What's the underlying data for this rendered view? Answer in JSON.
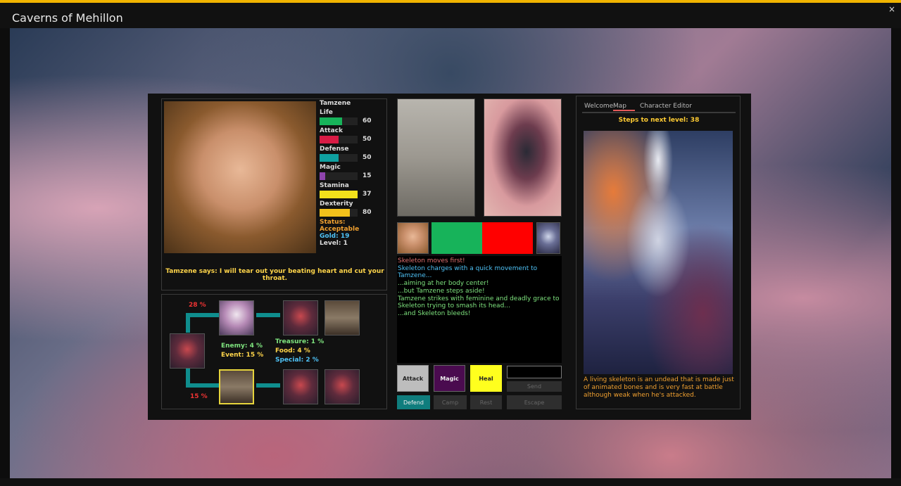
{
  "app": {
    "title": "Caverns of Mehillon",
    "close": "×"
  },
  "character": {
    "name": "Tamzene",
    "stats": [
      {
        "label": "Life",
        "value": "60",
        "fill": 0.6,
        "color": "#17b35a"
      },
      {
        "label": "Attack",
        "value": "50",
        "fill": 0.5,
        "color": "#d81b45"
      },
      {
        "label": "Defense",
        "value": "50",
        "fill": 0.5,
        "color": "#0fa0a0"
      },
      {
        "label": "Magic",
        "value": "15",
        "fill": 0.15,
        "color": "#8e44ad"
      },
      {
        "label": "Stamina",
        "value": "37",
        "fill": 1.0,
        "color": "#f2e11b"
      },
      {
        "label": "Dexterity",
        "value": "80",
        "fill": 0.8,
        "color": "#f2c11b"
      }
    ],
    "status": "Status: Acceptable",
    "gold": "Gold: 19",
    "level": "Level: 1",
    "says": "Tamzene says: I will tear out your beating heart and cut your throat."
  },
  "map": {
    "pct_top": "28 %",
    "pct_bottom": "15 %",
    "enemy": "Enemy: 4 %",
    "event": "Event: 15 %",
    "treasure": "Treasure: 1 %",
    "food": "Food: 4 %",
    "special": "Special: 2 %"
  },
  "log": [
    {
      "text": "Skeleton moves first!",
      "color": "#e07070"
    },
    {
      "text": "Skeleton charges with a quick movement to Tamzene...",
      "color": "#4fc3f7"
    },
    {
      "text": "...aiming at her body center!",
      "color": "#7ee37e"
    },
    {
      "text": "...but Tamzene steps aside!",
      "color": "#7ee37e"
    },
    {
      "text": "Tamzene strikes with feminine and deadly grace to Skeleton trying to smash its head...",
      "color": "#7ee37e"
    },
    {
      "text": "...and Skeleton bleeds!",
      "color": "#7ee37e"
    }
  ],
  "buttons": {
    "attack": "Attack",
    "magic": "Magic",
    "heal": "Heal",
    "send": "Send",
    "defend": "Defend",
    "camp": "Camp",
    "rest": "Rest",
    "escape": "Escape"
  },
  "right": {
    "tabs": [
      "Welcome",
      "Map",
      "Character Editor"
    ],
    "steps": "Steps to next level: 38",
    "description": "A living skeleton is an undead that is made just of animated bones and is very fast at battle although weak when he's attacked."
  }
}
